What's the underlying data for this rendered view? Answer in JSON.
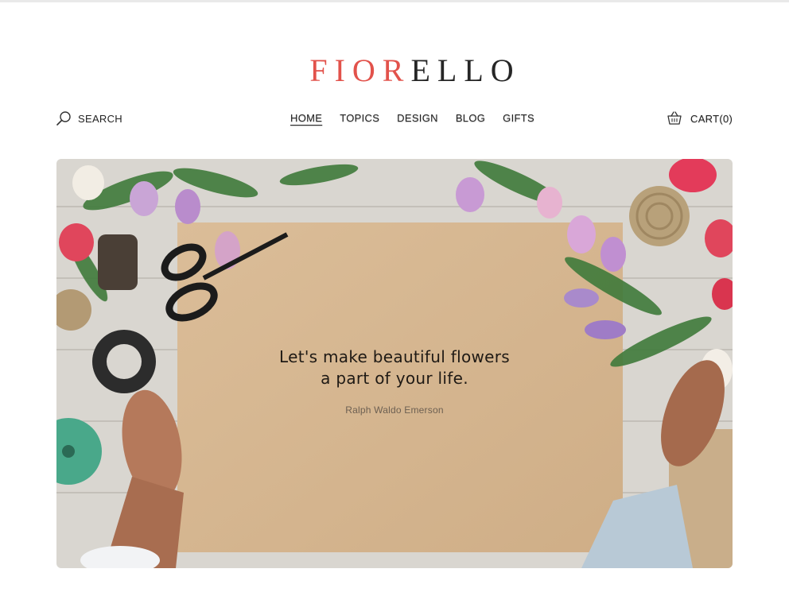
{
  "logo": {
    "part1": "FIOR",
    "part2": "ELLO"
  },
  "search": {
    "label": "SEARCH",
    "icon": "search-icon"
  },
  "nav": {
    "items": [
      {
        "label": "HOME",
        "active": true
      },
      {
        "label": "TOPICS"
      },
      {
        "label": "DESIGN"
      },
      {
        "label": "BLOG"
      },
      {
        "label": "GIFTS"
      }
    ]
  },
  "cart": {
    "label": "CART(0)",
    "icon": "basket-icon"
  },
  "hero": {
    "quote_line1": "Let's make beautiful flowers",
    "quote_line2": "a part of your life.",
    "author": "Ralph Waldo Emerson"
  },
  "colors": {
    "brand_red": "#e2524b",
    "text_dark": "#262626",
    "paper": "#d8b994",
    "wood": "#d9d6d0"
  }
}
